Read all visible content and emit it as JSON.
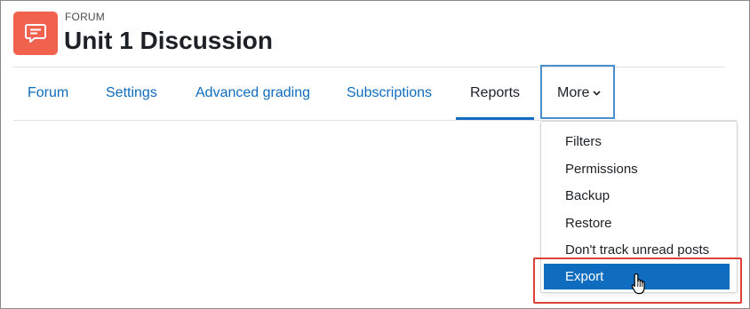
{
  "header": {
    "overline": "FORUM",
    "title": "Unit 1 Discussion",
    "icon": "forum-chat-icon",
    "icon_color": "#f0624d"
  },
  "tabs": [
    {
      "label": "Forum",
      "active": false
    },
    {
      "label": "Settings",
      "active": false
    },
    {
      "label": "Advanced grading",
      "active": false
    },
    {
      "label": "Subscriptions",
      "active": false
    },
    {
      "label": "Reports",
      "active": true
    }
  ],
  "more_menu": {
    "label": "More",
    "icon": "chevron-down-icon",
    "items": [
      {
        "label": "Filters"
      },
      {
        "label": "Permissions"
      },
      {
        "label": "Backup"
      },
      {
        "label": "Restore"
      },
      {
        "label": "Don't track unread posts"
      },
      {
        "label": "Export",
        "highlighted": true
      }
    ]
  },
  "colors": {
    "link": "#0f6cbf",
    "text": "#1d2125",
    "annotation_red": "#e0403a",
    "annotation_blue": "#4a90cf"
  }
}
